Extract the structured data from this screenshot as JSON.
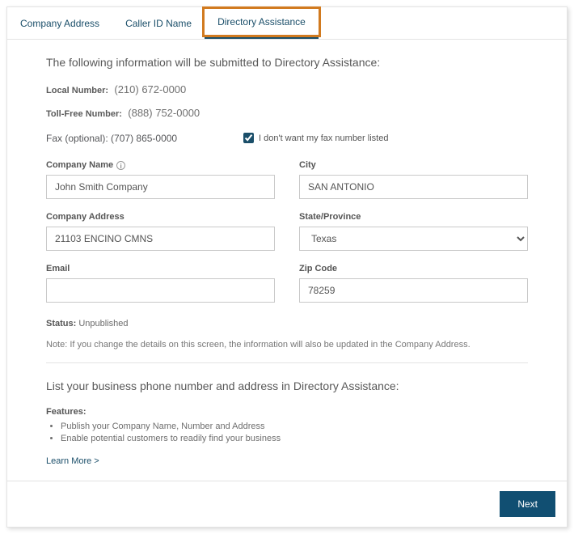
{
  "tabs": {
    "company_address": "Company Address",
    "caller_id_name": "Caller ID Name",
    "directory_assistance": "Directory Assistance"
  },
  "heading": "The following information will be submitted to Directory Assistance:",
  "local_number": {
    "label": "Local Number:",
    "value": "(210) 672-0000"
  },
  "toll_free": {
    "label": "Toll-Free Number:",
    "value": "(888) 752-0000"
  },
  "fax": {
    "label": "Fax (optional):",
    "value": "(707) 865-0000"
  },
  "fax_checkbox_label": "I don't want my fax number listed",
  "form": {
    "company_name": {
      "label": "Company Name",
      "value": "John Smith Company"
    },
    "company_address": {
      "label": "Company Address",
      "value": "21103 ENCINO CMNS"
    },
    "email": {
      "label": "Email",
      "value": ""
    },
    "city": {
      "label": "City",
      "value": "SAN ANTONIO"
    },
    "state": {
      "label": "State/Province",
      "value": "Texas"
    },
    "zip": {
      "label": "Zip Code",
      "value": "78259"
    }
  },
  "status": {
    "label": "Status:",
    "value": "Unpublished"
  },
  "note": "Note: If you change the details on this screen, the information will also be updated in the Company Address.",
  "section2_heading": "List your business phone number and address in Directory Assistance:",
  "features_label": "Features:",
  "features": [
    "Publish your Company Name, Number and Address",
    "Enable potential customers to readily find your business"
  ],
  "learn_more": "Learn More >",
  "next": "Next"
}
